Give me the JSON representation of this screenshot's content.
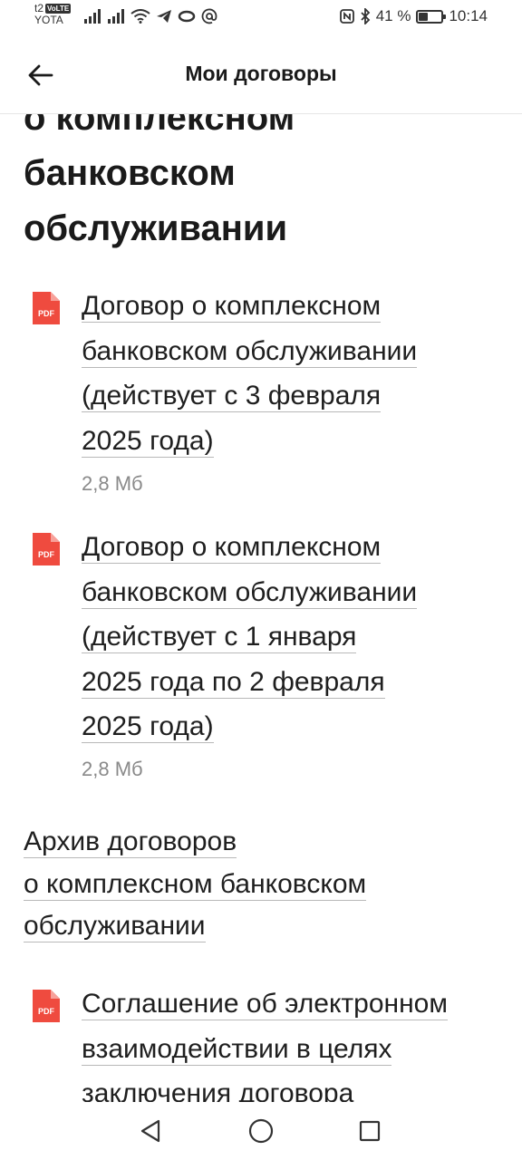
{
  "status_bar": {
    "carrier_top": "t2",
    "volte": "VoLTE",
    "carrier_bottom": "YOTA",
    "battery_text": "41 %",
    "battery_level": 0.41,
    "time": "10:14"
  },
  "header": {
    "title": "Мои договоры",
    "back_icon": "arrow-left-icon"
  },
  "section_title": "о комплексном банковском обслуживании",
  "documents": [
    {
      "lines": [
        "Договор о комплексном",
        "банковском обслуживании",
        "(действует с 3 февраля",
        "2025 года)"
      ],
      "size": "2,8 Мб",
      "icon": "pdf-icon",
      "icon_label": "PDF"
    },
    {
      "lines": [
        "Договор о комплексном",
        "банковском обслуживании",
        "(действует с 1 января",
        "2025 года по 2 февраля",
        "2025 года)"
      ],
      "size": "2,8 Мб",
      "icon": "pdf-icon",
      "icon_label": "PDF"
    }
  ],
  "archive": {
    "lines": [
      "Архив договоров",
      "о комплексном банковском",
      "обслуживании"
    ]
  },
  "agreement": {
    "lines": [
      "Соглашение об электронном",
      "взаимодействии в целях",
      "заключения договора"
    ],
    "icon": "pdf-icon",
    "icon_label": "PDF"
  },
  "nav": [
    "back-triangle-icon",
    "home-circle-icon",
    "recents-square-icon"
  ],
  "colors": {
    "pdf_red": "#ef4b3f",
    "text": "#1f1f1f",
    "muted": "#8a8a8a",
    "underline": "#b8b8b8"
  }
}
